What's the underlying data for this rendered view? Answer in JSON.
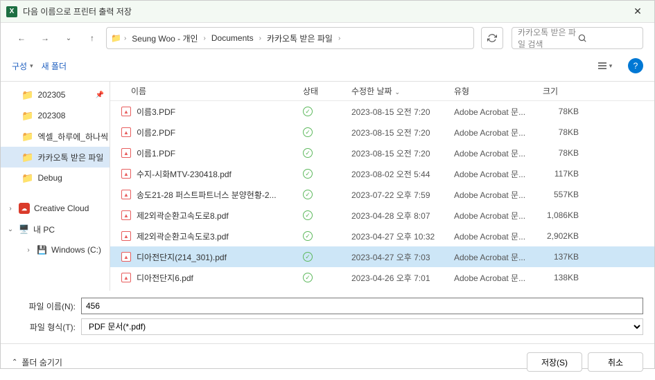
{
  "titlebar": {
    "app_glyph": "X",
    "title": "다음 이름으로 프린터 출력 저장"
  },
  "breadcrumb": {
    "items": [
      "Seung Woo - 개인",
      "Documents",
      "카카오톡 받은 파일"
    ]
  },
  "search": {
    "placeholder": "카카오톡 받은 파일 검색"
  },
  "toolbar": {
    "organize": "구성",
    "new_folder": "새 폴더"
  },
  "sidebar": {
    "items": [
      {
        "label": "202305",
        "icon": "folder",
        "pinned": true
      },
      {
        "label": "202308",
        "icon": "folder"
      },
      {
        "label": "엑셀_하루에_하나씩",
        "icon": "folder"
      },
      {
        "label": "카카오톡 받은 파일",
        "icon": "folder",
        "selected": true
      },
      {
        "label": "Debug",
        "icon": "folder"
      }
    ],
    "groups": [
      {
        "label": "Creative Cloud",
        "chev": "›",
        "icon": "cc"
      },
      {
        "label": "내 PC",
        "chev": "⌄",
        "icon": "pc",
        "children": [
          {
            "label": "Windows (C:)",
            "icon": "drive",
            "chev": "›"
          }
        ]
      }
    ]
  },
  "columns": {
    "name": "이름",
    "status": "상태",
    "date": "수정한 날짜",
    "type": "유형",
    "size": "크기"
  },
  "files": [
    {
      "name": "이름3.PDF",
      "date": "2023-08-15 오전 7:20",
      "type": "Adobe Acrobat 문...",
      "size": "78KB"
    },
    {
      "name": "이름2.PDF",
      "date": "2023-08-15 오전 7:20",
      "type": "Adobe Acrobat 문...",
      "size": "78KB"
    },
    {
      "name": "이름1.PDF",
      "date": "2023-08-15 오전 7:20",
      "type": "Adobe Acrobat 문...",
      "size": "78KB"
    },
    {
      "name": "수지-시화MTV-230418.pdf",
      "date": "2023-08-02 오전 5:44",
      "type": "Adobe Acrobat 문...",
      "size": "117KB"
    },
    {
      "name": "송도21-28 퍼스트파트너스 분양현황-2...",
      "date": "2023-07-22 오후 7:59",
      "type": "Adobe Acrobat 문...",
      "size": "557KB"
    },
    {
      "name": "제2외곽순환고속도로8.pdf",
      "date": "2023-04-28 오후 8:07",
      "type": "Adobe Acrobat 문...",
      "size": "1,086KB"
    },
    {
      "name": "제2외곽순환고속도로3.pdf",
      "date": "2023-04-27 오후 10:32",
      "type": "Adobe Acrobat 문...",
      "size": "2,902KB"
    },
    {
      "name": "디아전단지(214_301).pdf",
      "date": "2023-04-27 오후 7:03",
      "type": "Adobe Acrobat 문...",
      "size": "137KB",
      "selected": true
    },
    {
      "name": "디아전단지6.pdf",
      "date": "2023-04-26 오후 7:01",
      "type": "Adobe Acrobat 문...",
      "size": "138KB"
    }
  ],
  "form": {
    "filename_label": "파일 이름(N):",
    "filename_value": "456",
    "filetype_label": "파일 형식(T):",
    "filetype_value": "PDF 문서(*.pdf)"
  },
  "footer": {
    "hide_folders": "폴더 숨기기",
    "save": "저장(S)",
    "cancel": "취소"
  }
}
